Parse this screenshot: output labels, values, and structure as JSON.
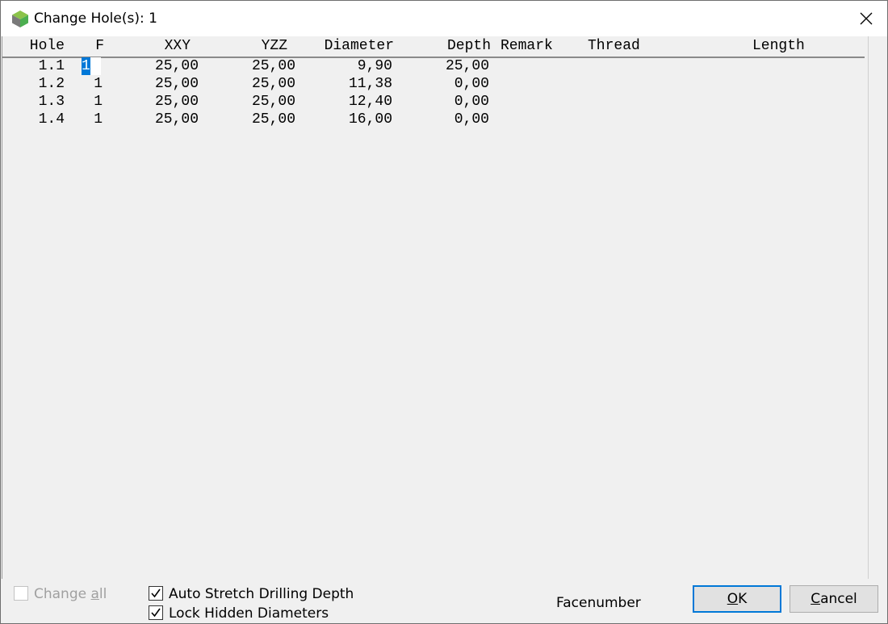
{
  "window": {
    "title": "Change Hole(s): 1",
    "accent": "#0078d7"
  },
  "table": {
    "columns": [
      "Hole",
      "F",
      "XXY",
      "YZZ",
      "Diameter",
      "Depth",
      "Remark",
      "Thread",
      "Length"
    ],
    "rows": [
      {
        "hole": "1.1",
        "f": "1",
        "xxy": "25,00",
        "yzz": "25,00",
        "diameter": "9,90",
        "depth": "25,00"
      },
      {
        "hole": "1.2",
        "f": "1",
        "xxy": "25,00",
        "yzz": "25,00",
        "diameter": "11,38",
        "depth": "0,00"
      },
      {
        "hole": "1.3",
        "f": "1",
        "xxy": "25,00",
        "yzz": "25,00",
        "diameter": "12,40",
        "depth": "0,00"
      },
      {
        "hole": "1.4",
        "f": "1",
        "xxy": "25,00",
        "yzz": "25,00",
        "diameter": "16,00",
        "depth": "0,00"
      }
    ]
  },
  "options": {
    "change_all": {
      "label_pre": "Change ",
      "label_accel": "a",
      "label_post": "ll",
      "checked": false,
      "enabled": false
    },
    "auto_stretch": {
      "label": "Auto Stretch Drilling Depth",
      "checked": true
    },
    "lock_hidden": {
      "label": "Lock Hidden Diameters",
      "checked": true
    }
  },
  "status": {
    "facenumber": "Facenumber"
  },
  "buttons": {
    "ok": {
      "accel": "O",
      "rest": "K"
    },
    "cancel": {
      "accel": "C",
      "rest": "ancel"
    }
  }
}
